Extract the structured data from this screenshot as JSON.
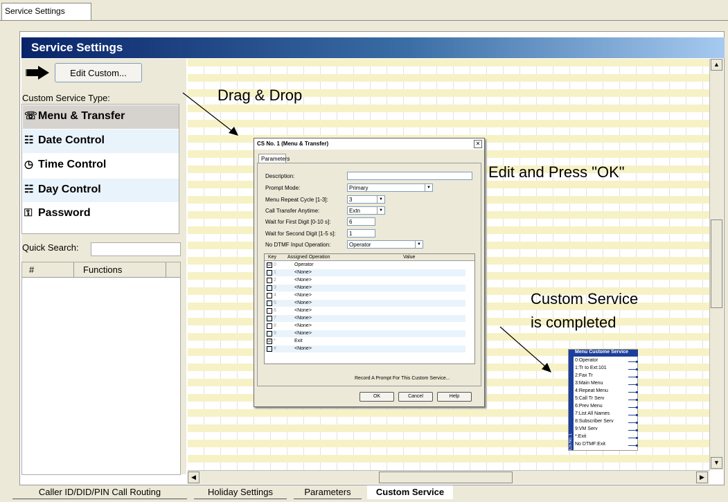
{
  "top_tab": "Service Settings",
  "title": "Service Settings",
  "edit_button": "Edit Custom...",
  "custom_service_type_label": "Custom Service Type:",
  "service_types": [
    {
      "label": "Menu & Transfer",
      "icon": "menu-transfer-icon",
      "glyph": "☏"
    },
    {
      "label": "Date Control",
      "icon": "date-control-icon",
      "glyph": "☷"
    },
    {
      "label": "Time Control",
      "icon": "clock-icon",
      "glyph": "◷"
    },
    {
      "label": "Day Control",
      "icon": "day-control-icon",
      "glyph": "☵"
    },
    {
      "label": "Password",
      "icon": "key-icon",
      "glyph": "⚿"
    }
  ],
  "quick_search_label": "Quick Search:",
  "functions_table": {
    "col1": "#",
    "col2": "Functions"
  },
  "annotations": {
    "drag_drop": "Drag & Drop",
    "edit_ok": "Edit and Press \"OK\"",
    "completed_line1": "Custom Service",
    "completed_line2": "is completed"
  },
  "dialog": {
    "title": "CS No. 1 (Menu & Transfer)",
    "tab": "Parameters",
    "fields": {
      "description": {
        "label": "Description:",
        "value": ""
      },
      "prompt_mode": {
        "label": "Prompt Mode:",
        "value": "Primary"
      },
      "menu_repeat": {
        "label": "Menu Repeat Cycle [1-3]:",
        "value": "3"
      },
      "call_transfer": {
        "label": "Call Transfer Anytime:",
        "value": "Extn"
      },
      "wait_first": {
        "label": "Wait for First Digit [0-10 s]:",
        "value": "6"
      },
      "wait_second": {
        "label": "Wait for Second Digit [1-5 s]:",
        "value": "1"
      },
      "no_dtmf": {
        "label": "No DTMF Input Operation:",
        "value": "Operator"
      }
    },
    "table_headers": {
      "key": "Key",
      "op": "Assigned Operation",
      "value": "Value"
    },
    "rows": [
      {
        "key": "0",
        "op": "Operator",
        "checked": "☑"
      },
      {
        "key": "1",
        "op": "<None>",
        "checked": ""
      },
      {
        "key": "2",
        "op": "<None>",
        "checked": ""
      },
      {
        "key": "3",
        "op": "<None>",
        "checked": ""
      },
      {
        "key": "4",
        "op": "<None>",
        "checked": ""
      },
      {
        "key": "5",
        "op": "<None>",
        "checked": ""
      },
      {
        "key": "6",
        "op": "<None>",
        "checked": ""
      },
      {
        "key": "7",
        "op": "<None>",
        "checked": ""
      },
      {
        "key": "8",
        "op": "<None>",
        "checked": ""
      },
      {
        "key": "9",
        "op": "<None>",
        "checked": ""
      },
      {
        "key": "*",
        "op": "Exit",
        "checked": "☑"
      },
      {
        "key": "#",
        "op": "<None>",
        "checked": ""
      }
    ],
    "record_prompt": "Record A Prompt For This Custom Service...",
    "ok": "OK",
    "cancel": "Cancel",
    "help": "Help",
    "close_glyph": "✕"
  },
  "tree": {
    "title": "Menu Custome Service",
    "side_label": "CS No. 1",
    "items": [
      "0:Operator",
      "1:Tr to Ext:101",
      "2:Fax Tr",
      "3:Main Menu",
      "4:Repeat Menu",
      "5:Call Tr Serv",
      "6:Prev Menu",
      "7:List All Names",
      "8:Subscriber Serv",
      "9:VM Serv",
      "*:Exit",
      "No DTMF:Exit"
    ]
  },
  "bottom_tabs": [
    "Caller ID/DID/PIN Call Routing",
    "Holiday Settings",
    "Parameters",
    "Custom Service"
  ],
  "colors": {
    "title_bar": "#0a246a",
    "tree_accent": "#1c3e9c",
    "grid_stripe": "#f6f2c6"
  }
}
